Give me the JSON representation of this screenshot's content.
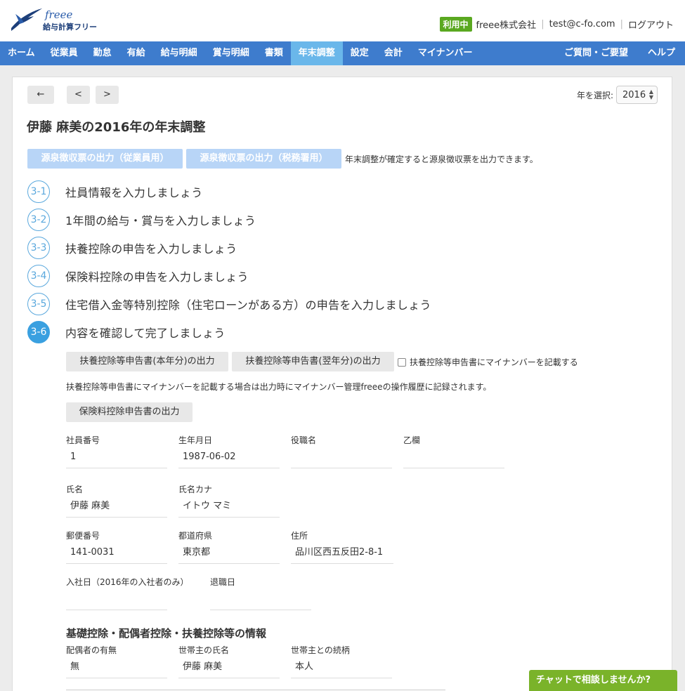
{
  "header": {
    "logo_text": "freee",
    "logo_sub": "給与計算フリー",
    "status_badge": "利用中",
    "company": "freee株式会社",
    "email": "test@c-fo.com",
    "logout": "ログアウト"
  },
  "nav": {
    "items": [
      "ホーム",
      "従業員",
      "勤怠",
      "有給",
      "給与明細",
      "賞与明細",
      "書類",
      "年末調整",
      "設定",
      "会計",
      "マイナンバー"
    ],
    "active": "年末調整",
    "right": [
      "ご質問・ご要望",
      "ヘルプ"
    ]
  },
  "toolbar": {
    "back_icon": "←",
    "prev_icon": "<",
    "next_icon": ">",
    "year_label": "年を選択:",
    "year_value": "2016"
  },
  "page_title": "伊藤 麻美の2016年の年末調整",
  "withholding": {
    "employee_btn": "源泉徴収票の出力（従業員用）",
    "tax_btn": "源泉徴収票の出力（税務署用）",
    "note": "年末調整が確定すると源泉徴収票を出力できます。"
  },
  "steps": [
    {
      "num": "3-1",
      "label": "社員情報を入力しましょう"
    },
    {
      "num": "3-2",
      "label": "1年間の給与・賞与を入力しましょう"
    },
    {
      "num": "3-3",
      "label": "扶養控除の申告を入力しましょう"
    },
    {
      "num": "3-4",
      "label": "保険料控除の申告を入力しましょう"
    },
    {
      "num": "3-5",
      "label": "住宅借入金等特別控除（住宅ローンがある方）の申告を入力しましょう"
    },
    {
      "num": "3-6",
      "label": "内容を確認して完了しましょう"
    }
  ],
  "outputs": {
    "current_year": "扶養控除等申告書(本年分)の出力",
    "next_year": "扶養控除等申告書(翌年分)の出力",
    "checkbox_label": "扶養控除等申告書にマイナンバーを記載する",
    "mynumber_note": "扶養控除等申告書にマイナンバーを記載する場合は出力時にマイナンバー管理freeeの操作履歴に記録されます。",
    "insurance": "保険料控除申告書の出力"
  },
  "fields": {
    "employee_no": {
      "label": "社員番号",
      "value": "1"
    },
    "birthdate": {
      "label": "生年月日",
      "value": "1987-06-02"
    },
    "position": {
      "label": "役職名",
      "value": ""
    },
    "otsu": {
      "label": "乙欄",
      "value": ""
    },
    "name": {
      "label": "氏名",
      "value": "伊藤 麻美"
    },
    "name_kana": {
      "label": "氏名カナ",
      "value": "イトウ マミ"
    },
    "postal": {
      "label": "郵便番号",
      "value": "141-0031"
    },
    "prefecture": {
      "label": "都道府県",
      "value": "東京都"
    },
    "address": {
      "label": "住所",
      "value": "品川区西五反田2-8-1"
    },
    "join_date": {
      "label": "入社日（2016年の入社者のみ）",
      "value": ""
    },
    "leave_date": {
      "label": "退職日",
      "value": ""
    }
  },
  "deduction_section": {
    "title": "基礎控除・配偶者控除・扶養控除等の情報",
    "spouse": {
      "label": "配偶者の有無",
      "value": "無"
    },
    "householder_name": {
      "label": "世帯主の氏名",
      "value": "伊藤 麻美"
    },
    "householder_rel": {
      "label": "世帯主との続柄",
      "value": "本人"
    }
  },
  "chat": {
    "label": "チャットで相談しませんか?"
  }
}
